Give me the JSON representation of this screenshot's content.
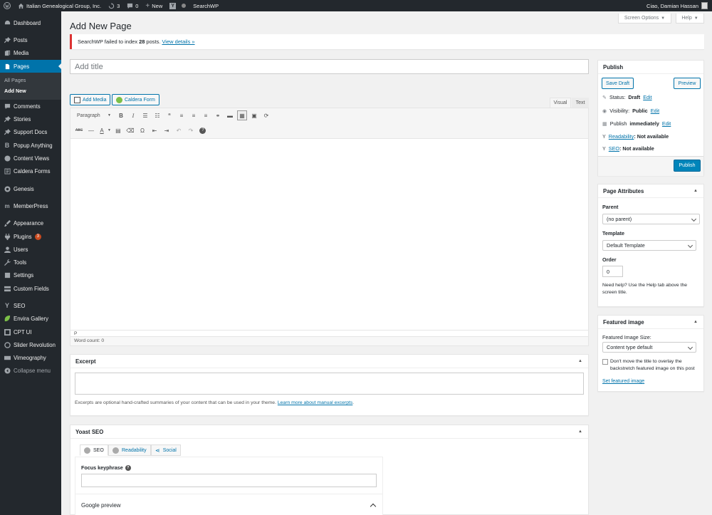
{
  "adminbar": {
    "site_name": "Italian Genealogical Group, Inc.",
    "updates": "3",
    "comments": "0",
    "new_label": "New",
    "searchwp": "SearchWP",
    "greeting": "Ciao, Damian Hassan"
  },
  "sidebar": {
    "items": [
      {
        "label": "Dashboard",
        "icon": "dashboard-icon"
      },
      {
        "label": "Posts",
        "icon": "pin-icon"
      },
      {
        "label": "Media",
        "icon": "media-icon"
      },
      {
        "label": "Pages",
        "icon": "pages-icon"
      },
      {
        "label": "Comments",
        "icon": "comment-icon"
      },
      {
        "label": "Stories",
        "icon": "pin-icon"
      },
      {
        "label": "Support Docs",
        "icon": "pin-icon"
      },
      {
        "label": "Popup Anything",
        "icon": "b-icon"
      },
      {
        "label": "Content Views",
        "icon": "cv-icon"
      },
      {
        "label": "Caldera Forms",
        "icon": "form-icon"
      },
      {
        "label": "Genesis",
        "icon": "genesis-icon"
      },
      {
        "label": "MemberPress",
        "icon": "mp-icon"
      },
      {
        "label": "Appearance",
        "icon": "brush-icon"
      },
      {
        "label": "Plugins",
        "icon": "plug-icon",
        "badge": "3"
      },
      {
        "label": "Users",
        "icon": "user-icon"
      },
      {
        "label": "Tools",
        "icon": "wrench-icon"
      },
      {
        "label": "Settings",
        "icon": "settings-icon"
      },
      {
        "label": "Custom Fields",
        "icon": "fields-icon"
      },
      {
        "label": "SEO",
        "icon": "yoast-icon"
      },
      {
        "label": "Envira Gallery",
        "icon": "leaf-icon"
      },
      {
        "label": "CPT UI",
        "icon": "cpt-icon"
      },
      {
        "label": "Slider Revolution",
        "icon": "slider-icon"
      },
      {
        "label": "Vimeography",
        "icon": "vimeo-icon"
      },
      {
        "label": "Collapse menu",
        "icon": "collapse-icon"
      }
    ],
    "submenu": [
      "All Pages",
      "Add New"
    ]
  },
  "top_buttons": {
    "screen_options": "Screen Options",
    "help": "Help"
  },
  "page_title": "Add New Page",
  "notice": {
    "text_before": "SearchWP failed to index",
    "count": "28",
    "text_after": "posts.",
    "link": "View details »"
  },
  "title_placeholder": "Add title",
  "editor": {
    "add_media": "Add Media",
    "caldera_form": "Caldera Form",
    "tab_visual": "Visual",
    "tab_text": "Text",
    "format": "Paragraph",
    "path": "P",
    "word_count": "Word count: 0"
  },
  "excerpt": {
    "title": "Excerpt",
    "help_text": "Excerpts are optional hand-crafted summaries of your content that can be used in your theme.",
    "help_link": "Learn more about manual excerpts",
    "help_end": "."
  },
  "yoast": {
    "title": "Yoast SEO",
    "tabs": [
      "SEO",
      "Readability",
      "Social"
    ],
    "focus_label": "Focus keyphrase",
    "google_preview": "Google preview"
  },
  "publish": {
    "title": "Publish",
    "save_draft": "Save Draft",
    "preview": "Preview",
    "status_label": "Status:",
    "status_value": "Draft",
    "visibility_label": "Visibility:",
    "visibility_value": "Public",
    "publish_label": "Publish",
    "publish_value": "immediately",
    "edit": "Edit",
    "readability_link": "Readability",
    "readability_value": ": Not available",
    "seo_link": "SEO",
    "seo_value": ": Not available",
    "publish_button": "Publish"
  },
  "page_attributes": {
    "title": "Page Attributes",
    "parent_label": "Parent",
    "parent_value": "(no parent)",
    "template_label": "Template",
    "template_value": "Default Template",
    "order_label": "Order",
    "order_value": "0",
    "help": "Need help? Use the Help tab above the screen title."
  },
  "featured": {
    "title": "Featured image",
    "size_label": "Featured Image Size:",
    "size_value": "Content type default",
    "checkbox_label": "Don't move the title to overlay the backstretch featured image on this post",
    "set_link": "Set featured image"
  },
  "colors": {
    "accent": "#0073aa",
    "sidebar_bg": "#23282d",
    "notice_error": "#dc3232"
  }
}
